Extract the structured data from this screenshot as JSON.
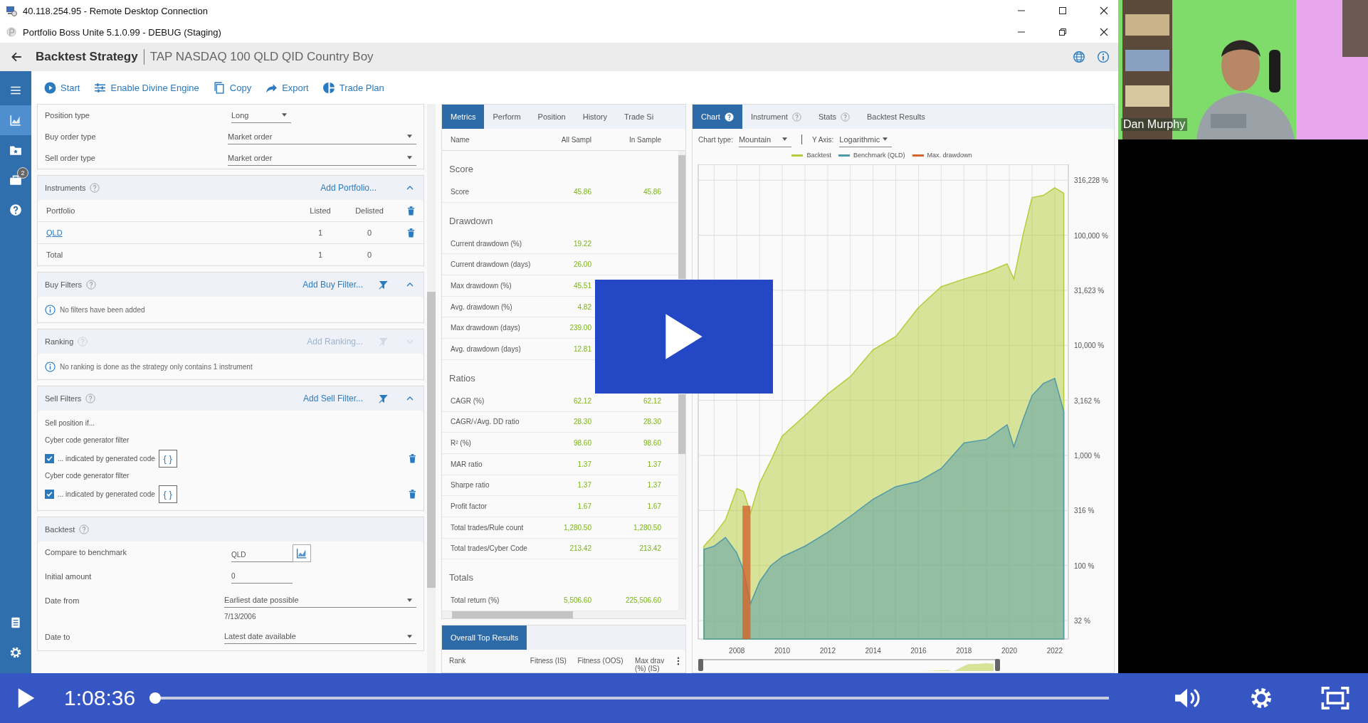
{
  "remote_window": {
    "title": "40.118.254.95 - Remote Desktop Connection"
  },
  "app_window": {
    "title": "Portfolio Boss Unite 5.1.0.99 - DEBUG (Staging)"
  },
  "header": {
    "title": "Backtest Strategy",
    "subtitle": "TAP NASDAQ 100 QLD QID Country Boy"
  },
  "sidebar": {
    "items": [
      {
        "kind": "menu",
        "selected": false
      },
      {
        "kind": "chart",
        "selected": true
      },
      {
        "kind": "folder",
        "selected": false
      },
      {
        "kind": "briefcase",
        "selected": false,
        "badge": "2"
      },
      {
        "kind": "help",
        "selected": false
      }
    ],
    "bottom_items": [
      {
        "kind": "document",
        "selected": false
      },
      {
        "kind": "gear",
        "selected": false
      }
    ]
  },
  "toolbar": [
    {
      "kind": "start",
      "label": "Start"
    },
    {
      "kind": "engine",
      "label": "Enable Divine Engine"
    },
    {
      "kind": "copy",
      "label": "Copy"
    },
    {
      "kind": "export",
      "label": "Export"
    },
    {
      "kind": "plan",
      "label": "Trade Plan"
    }
  ],
  "settings": [
    {
      "label": "Position type",
      "value": "Long",
      "kind": "short"
    },
    {
      "label": "Buy order type",
      "value": "Market order",
      "kind": "wide"
    },
    {
      "label": "Sell order type",
      "value": "Market order",
      "kind": "wide"
    }
  ],
  "instruments": {
    "title": "Instruments",
    "action": "Add Portfolio...",
    "expanded": true,
    "columns": [
      "Portfolio",
      "Listed",
      "Delisted"
    ],
    "rows": [
      {
        "name": "QLD",
        "listed": "1",
        "delisted": "0"
      }
    ],
    "total": {
      "label": "Total",
      "listed": "1",
      "delisted": "0"
    }
  },
  "filter_sections": [
    {
      "kind": "message",
      "title": "Buy Filters",
      "action": "Add Buy Filter...",
      "disabled": false,
      "expanded": true,
      "message": "No filters have been added"
    },
    {
      "kind": "message",
      "title": "Ranking",
      "action": "Add Ranking...",
      "disabled": true,
      "expanded": false,
      "message": "No ranking is done as the strategy only contains 1 instrument"
    },
    {
      "kind": "filters",
      "title": "Sell Filters",
      "action": "Add Sell Filter...",
      "disabled": false,
      "expanded": true,
      "intro": "Sell position if...",
      "filters": [
        {
          "name": "Cyber code generator filter",
          "label": "... indicated by generated code",
          "checked": true,
          "code": "{ }"
        },
        {
          "name": "Cyber code generator filter",
          "label": "... indicated by generated code",
          "checked": true,
          "code": "{ }"
        }
      ]
    }
  ],
  "backtest": {
    "title": "Backtest",
    "rows": [
      {
        "kind": "benchmark",
        "label": "Compare to benchmark",
        "value": "QLD"
      },
      {
        "kind": "input",
        "label": "Initial amount",
        "value": "0"
      },
      {
        "kind": "date",
        "label": "Date from",
        "value": "Earliest date possible",
        "date": "7/13/2006"
      },
      {
        "kind": "dropdown",
        "label": "Date to",
        "value": "Latest date available"
      }
    ]
  },
  "metrics": {
    "tabs": [
      {
        "label": "Metrics",
        "selected": true
      },
      {
        "label": "Perform",
        "selected": false
      },
      {
        "label": "Position",
        "selected": false
      },
      {
        "label": "History",
        "selected": false
      },
      {
        "label": "Trade Si",
        "selected": false
      }
    ],
    "columns": [
      "Name",
      "All Sampl",
      "In Sample"
    ],
    "groups": [
      {
        "title": "Score",
        "rows": [
          {
            "name": "Score",
            "all": "45.86",
            "in": "45.86"
          }
        ]
      },
      {
        "title": "Drawdown",
        "rows": [
          {
            "name": "Current drawdown (%)",
            "all": "19.22"
          },
          {
            "name": "Current drawdown (days)",
            "all": "26.00"
          },
          {
            "name": "Max drawdown (%)",
            "all": "45.51"
          },
          {
            "name": "Avg. drawdown (%)",
            "all": "4.82"
          },
          {
            "name": "Max drawdown (days)",
            "all": "239.00"
          },
          {
            "name": "Avg. drawdown (days)",
            "all": "12.81"
          }
        ]
      },
      {
        "title": "Ratios",
        "rows": [
          {
            "name": "CAGR (%)",
            "all": "62.12",
            "in": "62.12"
          },
          {
            "name": "CAGR/√Avg. DD ratio",
            "all": "28.30",
            "in": "28.30"
          },
          {
            "name": "R² (%)",
            "all": "98.60",
            "in": "98.60"
          },
          {
            "name": "MAR ratio",
            "all": "1.37",
            "in": "1.37"
          },
          {
            "name": "Sharpe ratio",
            "all": "1.37",
            "in": "1.37"
          },
          {
            "name": "Profit factor",
            "all": "1.67",
            "in": "1.67"
          },
          {
            "name": "Total trades/Rule count",
            "all": "1,280.50",
            "in": "1,280.50"
          },
          {
            "name": "Total trades/Cyber Code",
            "all": "213.42",
            "in": "213.42"
          }
        ]
      },
      {
        "title": "Totals",
        "rows": [
          {
            "name": "Total return (%)",
            "all": "5,506.60",
            "in": "225,506.60"
          }
        ]
      }
    ]
  },
  "top_results": {
    "tab": "Overall Top Results",
    "columns": [
      "Rank",
      "Fitness (IS)",
      "Fitness (OOS)",
      "Max drav (%) (IS)"
    ]
  },
  "chart_panel": {
    "tabs": [
      {
        "label": "Chart",
        "selected": true,
        "help": true
      },
      {
        "label": "Instrument",
        "selected": false,
        "help": true
      },
      {
        "label": "Stats",
        "selected": false,
        "help": true
      },
      {
        "label": "Backtest Results",
        "selected": false,
        "help": false
      }
    ],
    "chart_type": {
      "label": "Chart type:",
      "value": "Mountain"
    },
    "y_axis": {
      "label": "Y Axis:",
      "value": "Logarithmic"
    },
    "legend": [
      {
        "label": "Backtest",
        "color": "#b5cc3a"
      },
      {
        "label": "Benchmark (QLD)",
        "color": "#4f9aa8"
      },
      {
        "label": "Max. drawdown",
        "color": "#d2642c"
      }
    ],
    "y_axis_labels": [
      "316,228 %",
      "100,000 %",
      "31,623 %",
      "10,000 %",
      "3,162 %",
      "1,000 %",
      "316 %",
      "100 %",
      "32 %"
    ],
    "x_axis_labels": [
      "2008",
      "2010",
      "2012",
      "2014",
      "2016",
      "2018",
      "2020",
      "2022"
    ]
  },
  "presenter": {
    "name": "Dan Murphy"
  },
  "player": {
    "time": "1:08:36",
    "level": 0,
    "playing": false
  }
}
